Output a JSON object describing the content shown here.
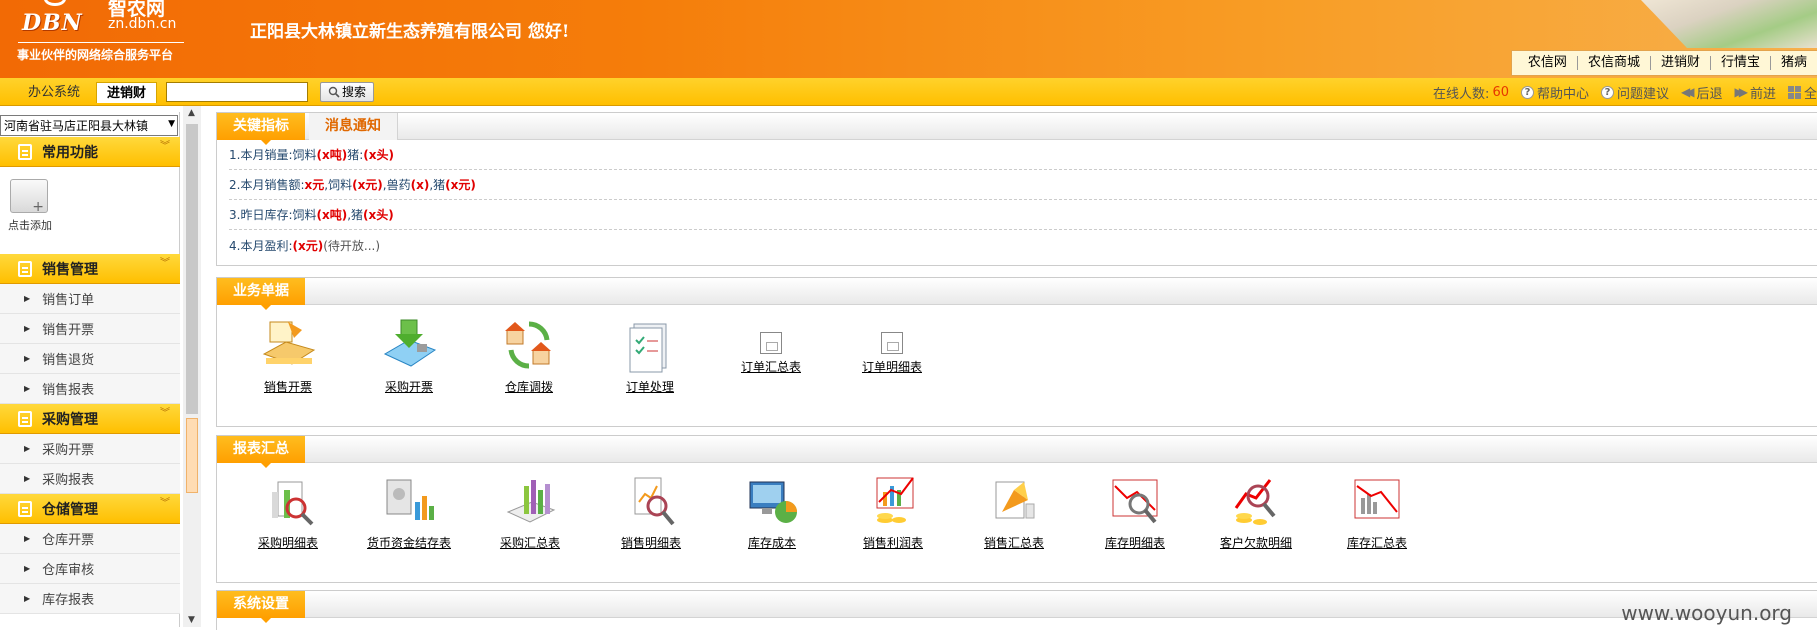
{
  "header": {
    "logo_text": "DBN",
    "logo_cn": "智农网",
    "logo_url": "zn.dbn.cn",
    "slogan": "事业伙伴的网络综合服务平台",
    "company_greeting": "正阳县大林镇立新生态养殖有限公司  您好!",
    "top_nav": [
      "农信网",
      "农信商城",
      "进销财",
      "行情宝",
      "猪病"
    ]
  },
  "toolbar": {
    "tab_office": "办公系统",
    "tab_jxc": "进销财",
    "search_value": "",
    "search_button": "搜索",
    "online_label": "在线人数:",
    "online_count": "60",
    "help": "帮助中心",
    "feedback": "问题建议",
    "back": "后退",
    "forward": "前进",
    "full": "全"
  },
  "sidebar": {
    "region": "河南省驻马店正阳县大林镇",
    "sections": [
      {
        "title": "常用功能",
        "items": []
      },
      {
        "title": "销售管理",
        "items": [
          "销售订单",
          "销售开票",
          "销售退货",
          "销售报表"
        ]
      },
      {
        "title": "采购管理",
        "items": [
          "采购开票",
          "采购报表"
        ]
      },
      {
        "title": "仓储管理",
        "items": [
          "仓库开票",
          "仓库审核",
          "库存报表"
        ]
      }
    ],
    "add_label": "点击添加"
  },
  "kpi": {
    "tabs": [
      "关键指标",
      "消息通知"
    ],
    "lines": [
      [
        {
          "t": "1.本月销量:饲料",
          "c": "n"
        },
        {
          "t": "(x吨)",
          "c": "r"
        },
        {
          "t": "猪:",
          "c": "n"
        },
        {
          "t": "(x头)",
          "c": "r"
        }
      ],
      [
        {
          "t": "2.本月销售额:",
          "c": "n"
        },
        {
          "t": "x元",
          "c": "r"
        },
        {
          "t": ",饲料",
          "c": "n"
        },
        {
          "t": "(x元)",
          "c": "r"
        },
        {
          "t": ",兽药",
          "c": "n"
        },
        {
          "t": "(x)",
          "c": "r"
        },
        {
          "t": ",猪",
          "c": "n"
        },
        {
          "t": "(x元)",
          "c": "r"
        }
      ],
      [
        {
          "t": "3.昨日库存:饲料",
          "c": "n"
        },
        {
          "t": "(x吨)",
          "c": "r"
        },
        {
          "t": ",猪",
          "c": "n"
        },
        {
          "t": "(x头)",
          "c": "r"
        }
      ],
      [
        {
          "t": "4.本月盈利:",
          "c": "n"
        },
        {
          "t": "(x元)",
          "c": "r"
        },
        {
          "t": "(待开放...)",
          "c": "g"
        }
      ]
    ]
  },
  "business": {
    "title": "业务单据",
    "tiles": [
      "销售开票",
      "采购开票",
      "仓库调拨",
      "订单处理",
      "订单汇总表",
      "订单明细表"
    ]
  },
  "reports": {
    "title": "报表汇总",
    "tiles": [
      "采购明细表",
      "货币资金结存表",
      "采购汇总表",
      "销售明细表",
      "库存成本",
      "销售利润表",
      "销售汇总表",
      "库存明细表",
      "客户欠款明细",
      "库存汇总表"
    ]
  },
  "system": {
    "title": "系统设置"
  },
  "watermark": "www.wooyun.org",
  "colors": {
    "accent": "#ff9f00",
    "header": "#f57d0a",
    "link": "#25496e",
    "value_red": "#e00000"
  }
}
